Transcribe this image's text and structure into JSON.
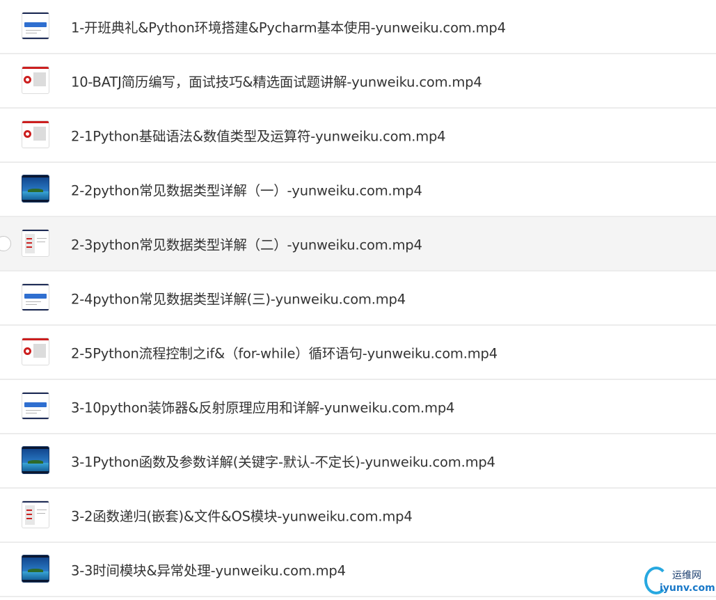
{
  "files": [
    {
      "name": "1-开班典礼&Python环境搭建&Pycharm基本使用-yunweiku.com.mp4",
      "thumb": "doc"
    },
    {
      "name": "10-BATJ简历编写，面试技巧&精选面试题讲解-yunweiku.com.mp4",
      "thumb": "red"
    },
    {
      "name": "2-1Python基础语法&数值类型及运算符-yunweiku.com.mp4",
      "thumb": "red"
    },
    {
      "name": "2-2python常见数据类型详解（一）-yunweiku.com.mp4",
      "thumb": "sea"
    },
    {
      "name": "2-3python常见数据类型详解（二）-yunweiku.com.mp4",
      "thumb": "screenshot"
    },
    {
      "name": "2-4python常见数据类型详解(三)-yunweiku.com.mp4",
      "thumb": "doc"
    },
    {
      "name": "2-5Python流程控制之if&（for-while）循环语句-yunweiku.com.mp4",
      "thumb": "red"
    },
    {
      "name": "3-10python装饰器&反射原理应用和详解-yunweiku.com.mp4",
      "thumb": "doc"
    },
    {
      "name": "3-1Python函数及参数详解(关键字-默认-不定长)-yunweiku.com.mp4",
      "thumb": "sea"
    },
    {
      "name": "3-2函数递归(嵌套)&文件&OS模块-yunweiku.com.mp4",
      "thumb": "screenshot"
    },
    {
      "name": "3-3时间模块&异常处理-yunweiku.com.mp4",
      "thumb": "sea"
    }
  ],
  "hovered_index": 4,
  "watermark": {
    "cn": "运维网",
    "en": "iyunv.com"
  },
  "colors": {
    "text": "#333333",
    "hover_bg": "#f4f4f4",
    "divider": "#ececec",
    "watermark_blue": "#27a8e0"
  }
}
